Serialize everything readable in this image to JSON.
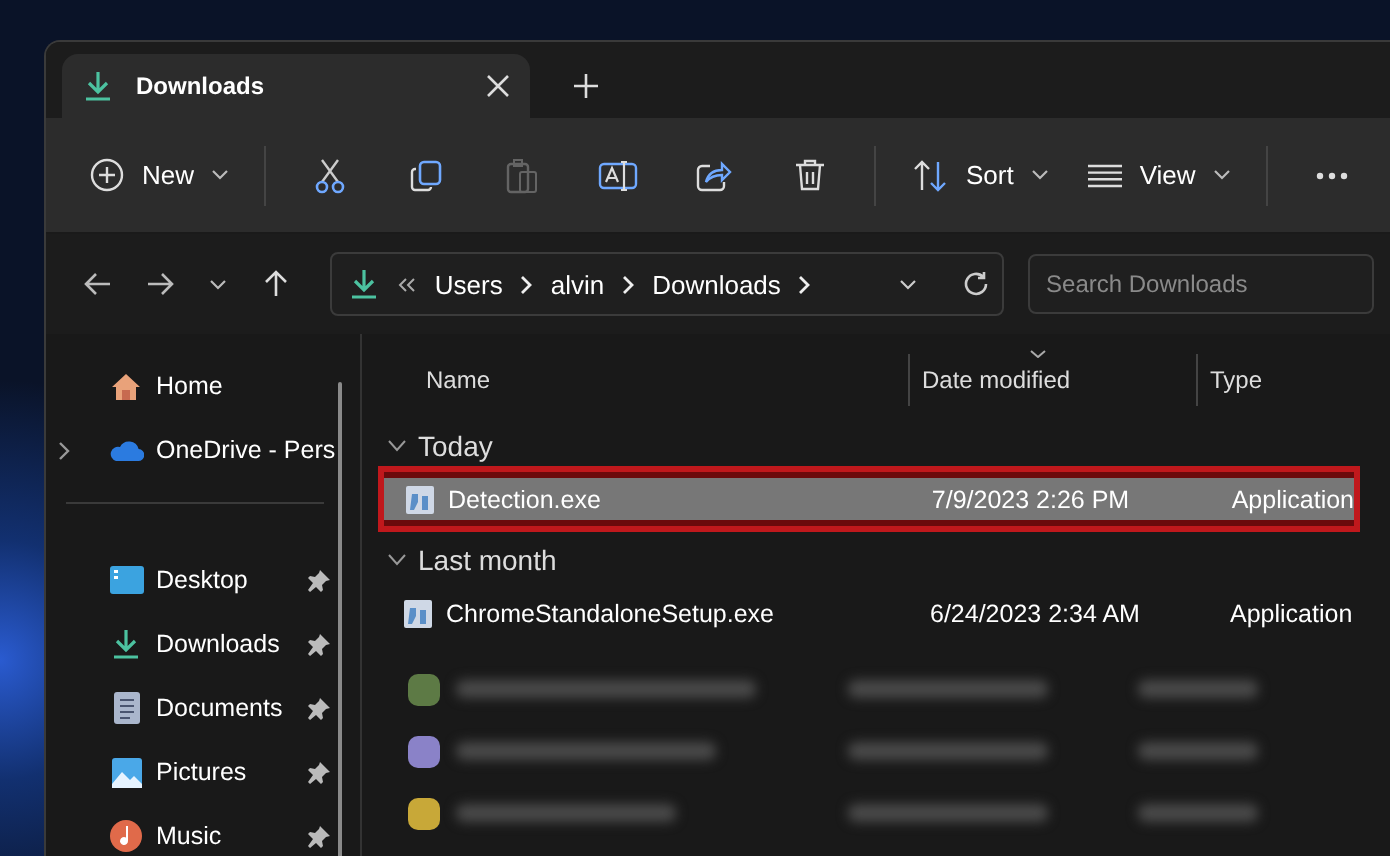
{
  "tabs": [
    {
      "label": "Downloads",
      "selected": true
    }
  ],
  "toolbar": {
    "buttons": [
      {
        "kind": "new",
        "label": "New",
        "disabled": false
      },
      {
        "kind": "cut",
        "disabled": false
      },
      {
        "kind": "copy",
        "disabled": false
      },
      {
        "kind": "paste",
        "disabled": true
      },
      {
        "kind": "rename",
        "disabled": false
      },
      {
        "kind": "share",
        "disabled": false
      },
      {
        "kind": "delete",
        "disabled": false
      },
      {
        "kind": "sort",
        "label": "Sort",
        "disabled": false
      },
      {
        "kind": "view",
        "label": "View",
        "disabled": false
      },
      {
        "kind": "more",
        "disabled": false
      }
    ]
  },
  "address": {
    "crumbs": [
      "Users",
      "alvin",
      "Downloads"
    ],
    "search_placeholder": "Search Downloads"
  },
  "sidebar": {
    "groups": [
      [
        {
          "kind": "home",
          "label": "Home",
          "pinned": false,
          "expandable": false
        },
        {
          "kind": "cloud",
          "label": "OneDrive - Pers",
          "pinned": false,
          "expandable": true
        }
      ],
      [
        {
          "kind": "desktop",
          "label": "Desktop",
          "pinned": true,
          "expandable": false
        },
        {
          "kind": "downloads",
          "label": "Downloads",
          "pinned": true,
          "expandable": false
        },
        {
          "kind": "documents",
          "label": "Documents",
          "pinned": true,
          "expandable": false
        },
        {
          "kind": "pictures",
          "label": "Pictures",
          "pinned": true,
          "expandable": false
        },
        {
          "kind": "music",
          "label": "Music",
          "pinned": true,
          "expandable": false
        }
      ]
    ]
  },
  "file_list": {
    "columns": [
      {
        "label": "Name",
        "sorted": false
      },
      {
        "label": "Date modified",
        "sorted": true
      },
      {
        "label": "Type",
        "sorted": false
      }
    ],
    "groups": [
      {
        "label": "Today",
        "expanded": true,
        "files": [
          {
            "name": "Detection.exe",
            "date": "7/9/2023 2:26 PM",
            "type": "Application",
            "selected": true,
            "highlighted": true
          }
        ]
      },
      {
        "label": "Last month",
        "expanded": true,
        "files": [
          {
            "name": "ChromeStandaloneSetup.exe",
            "date": "6/24/2023 2:34 AM",
            "type": "Application",
            "selected": false,
            "highlighted": false
          }
        ]
      }
    ],
    "blurred_rows": [
      {
        "color": "#5d7a45"
      },
      {
        "color": "#8a82c8"
      },
      {
        "color": "#c8a838"
      }
    ]
  }
}
